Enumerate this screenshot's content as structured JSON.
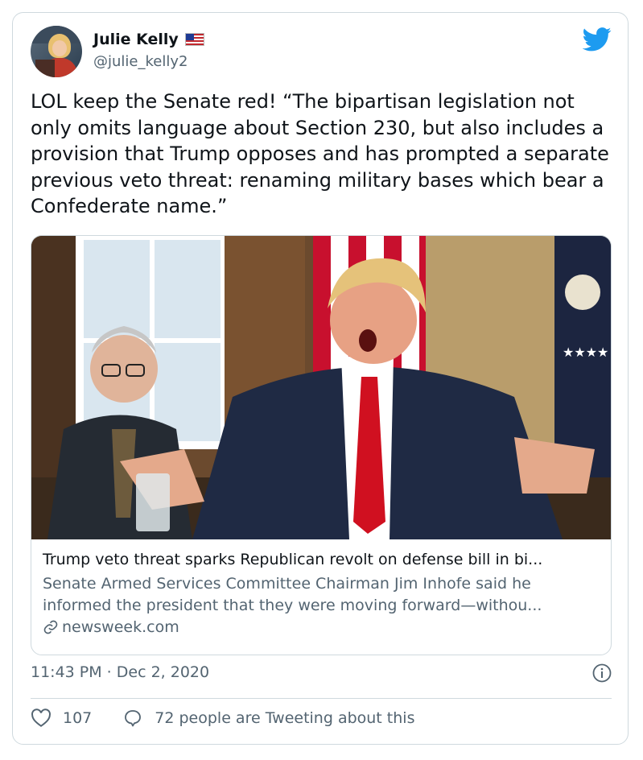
{
  "author": {
    "name": "Julie Kelly",
    "handle": "@julie_kelly2",
    "flag_icon": "us-flag-icon"
  },
  "tweet": {
    "text": "LOL keep the Senate red! “The bipartisan legislation not only omits language about Section 230, but also includes a provision that Trump opposes and has prompted a separate previous veto threat: renaming military bases which bear a Confederate name.”"
  },
  "link_card": {
    "title": "Trump veto threat sparks Republican revolt on defense bill in bi...",
    "description": "Senate Armed Services Committee Chairman Jim Inhofe said he informed the president that they were moving forward—withou...",
    "domain": "newsweek.com"
  },
  "timestamp": "11:43 PM · Dec 2, 2020",
  "actions": {
    "likes": "107",
    "tweeting_about": "72 people are Tweeting about this"
  },
  "colors": {
    "twitter_blue": "#1d9bf0",
    "secondary_text": "#536471",
    "border": "#cfd9de"
  }
}
